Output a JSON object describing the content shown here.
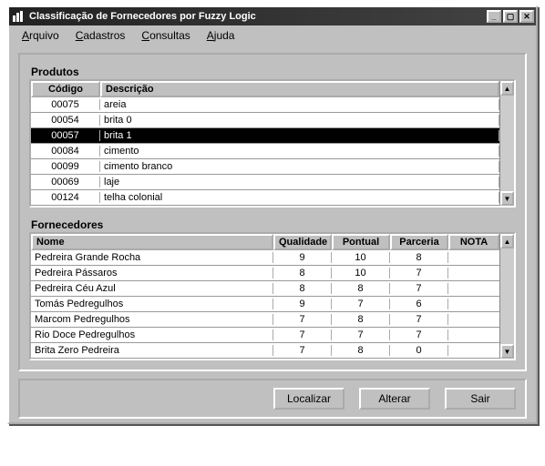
{
  "window": {
    "title": "Classificação de Fornecedores por Fuzzy Logic"
  },
  "menu": {
    "arquivo_hot": "A",
    "arquivo_rest": "rquivo",
    "cadastros_hot": "C",
    "cadastros_rest": "adastros",
    "consultas_hot": "C",
    "consultas_rest": "onsultas",
    "ajuda_hot": "A",
    "ajuda_rest": "juda"
  },
  "produtos": {
    "label": "Produtos",
    "col_codigo": "Código",
    "col_descricao": "Descrição",
    "rows": [
      {
        "codigo": "00075",
        "descricao": "areia",
        "selected": false
      },
      {
        "codigo": "00054",
        "descricao": "brita 0",
        "selected": false
      },
      {
        "codigo": "00057",
        "descricao": "brita 1",
        "selected": true
      },
      {
        "codigo": "00084",
        "descricao": "cimento",
        "selected": false
      },
      {
        "codigo": "00099",
        "descricao": "cimento branco",
        "selected": false
      },
      {
        "codigo": "00069",
        "descricao": "laje",
        "selected": false
      },
      {
        "codigo": "00124",
        "descricao": "telha colonial",
        "selected": false
      }
    ]
  },
  "fornecedores": {
    "label": "Fornecedores",
    "col_nome": "Nome",
    "col_qualidade": "Qualidade",
    "col_pontual": "Pontual",
    "col_parceria": "Parceria",
    "col_nota": "NOTA",
    "rows": [
      {
        "nome": "Pedreira Grande Rocha",
        "qualidade": "9",
        "pontual": "10",
        "parceria": "8",
        "nota": ""
      },
      {
        "nome": "Pedreira Pássaros",
        "qualidade": "8",
        "pontual": "10",
        "parceria": "7",
        "nota": ""
      },
      {
        "nome": "Pedreira Céu Azul",
        "qualidade": "8",
        "pontual": "8",
        "parceria": "7",
        "nota": ""
      },
      {
        "nome": "Tomás Pedregulhos",
        "qualidade": "9",
        "pontual": "7",
        "parceria": "6",
        "nota": ""
      },
      {
        "nome": "Marcom Pedregulhos",
        "qualidade": "7",
        "pontual": "8",
        "parceria": "7",
        "nota": ""
      },
      {
        "nome": "Rio Doce Pedregulhos",
        "qualidade": "7",
        "pontual": "7",
        "parceria": "7",
        "nota": ""
      },
      {
        "nome": "Brita Zero Pedreira",
        "qualidade": "7",
        "pontual": "8",
        "parceria": "0",
        "nota": ""
      }
    ]
  },
  "buttons": {
    "localizar": "Localizar",
    "alterar": "Alterar",
    "sair": "Sair"
  }
}
